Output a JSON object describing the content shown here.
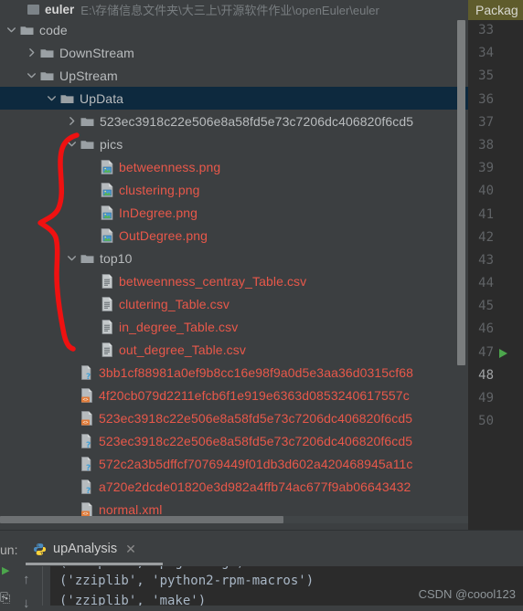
{
  "project_tree": {
    "header": {
      "name": "euler",
      "path": "E:\\存储信息文件夹\\大三上\\开源软件作业\\openEuler\\euler",
      "icon": "module-icon"
    },
    "rows": [
      {
        "label": "code",
        "type": "folder",
        "indent": 0,
        "chevron": "down",
        "selected": false
      },
      {
        "label": "DownStream",
        "type": "folder",
        "indent": 1,
        "chevron": "right",
        "selected": false
      },
      {
        "label": "UpStream",
        "type": "folder",
        "indent": 1,
        "chevron": "down",
        "selected": false
      },
      {
        "label": "UpData",
        "type": "folder",
        "indent": 2,
        "chevron": "down",
        "selected": true
      },
      {
        "label": "523ec3918c22e506e8a58fd5e73c7206dc406820f6cd5",
        "type": "folder",
        "indent": 3,
        "chevron": "right",
        "selected": false
      },
      {
        "label": "pics",
        "type": "folder",
        "indent": 3,
        "chevron": "down",
        "selected": false
      },
      {
        "label": "betweenness.png",
        "type": "image-file",
        "indent": 4,
        "chevron": "none",
        "selected": false
      },
      {
        "label": "clustering.png",
        "type": "image-file",
        "indent": 4,
        "chevron": "none",
        "selected": false
      },
      {
        "label": "InDegree.png",
        "type": "image-file",
        "indent": 4,
        "chevron": "none",
        "selected": false
      },
      {
        "label": "OutDegree.png",
        "type": "image-file",
        "indent": 4,
        "chevron": "none",
        "selected": false
      },
      {
        "label": "top10",
        "type": "folder",
        "indent": 3,
        "chevron": "down",
        "selected": false
      },
      {
        "label": "betweenness_centray_Table.csv",
        "type": "text-file",
        "indent": 4,
        "chevron": "none",
        "selected": false
      },
      {
        "label": "clutering_Table.csv",
        "type": "text-file",
        "indent": 4,
        "chevron": "none",
        "selected": false
      },
      {
        "label": "in_degree_Table.csv",
        "type": "text-file",
        "indent": 4,
        "chevron": "none",
        "selected": false
      },
      {
        "label": "out_degree_Table.csv",
        "type": "text-file",
        "indent": 4,
        "chevron": "none",
        "selected": false
      },
      {
        "label": "3bb1cf88981a0ef9b8cc16e98f9a0d5e3aa36d0315cf68",
        "type": "unknown-file",
        "indent": 3,
        "chevron": "none",
        "selected": false
      },
      {
        "label": "4f20cb079d2211efcb6f1e919e6363d0853240617557c",
        "type": "xml-file",
        "indent": 3,
        "chevron": "none",
        "selected": false
      },
      {
        "label": "523ec3918c22e506e8a58fd5e73c7206dc406820f6cd5",
        "type": "xml-file",
        "indent": 3,
        "chevron": "none",
        "selected": false
      },
      {
        "label": "523ec3918c22e506e8a58fd5e73c7206dc406820f6cd5",
        "type": "unknown-file",
        "indent": 3,
        "chevron": "none",
        "selected": false
      },
      {
        "label": "572c2a3b5dffcf70769449f01db3d602a420468945a11c",
        "type": "unknown-file",
        "indent": 3,
        "chevron": "none",
        "selected": false
      },
      {
        "label": "a720e2dcde01820e3d982a4ffb74ac677f9ab06643432",
        "type": "unknown-file",
        "indent": 3,
        "chevron": "none",
        "selected": false
      },
      {
        "label": "normal.xml",
        "type": "xml-file",
        "indent": 3,
        "chevron": "none",
        "selected": false
      }
    ],
    "annotation": {
      "color": "#ef1111",
      "shape": "hand-drawn-brace"
    }
  },
  "editor": {
    "tab_label": "Packag",
    "gutter_lines": [
      "33",
      "34",
      "35",
      "36",
      "37",
      "38",
      "39",
      "40",
      "41",
      "42",
      "43",
      "44",
      "45",
      "46",
      "47",
      "48",
      "49",
      "50"
    ],
    "current_line": "48",
    "run_arrow_line": "47",
    "run_arrow_color": "#4ca64c"
  },
  "run_panel": {
    "label": "un:",
    "tab_title": "upAnalysis",
    "tab_icon": "python-icon",
    "close_icon": "close-icon",
    "toolbar_icons": [
      "up-arrow-icon",
      "down-arrow-icon"
    ],
    "console_lines": [
      "('zziplib', 'pkgconfig')",
      "('zziplib', 'python2-rpm-macros')",
      "('zziplib', 'make')"
    ],
    "watermark": "CSDN @coool123"
  },
  "colors": {
    "panel_bg": "#3c3f41",
    "editor_bg": "#2b2b2b",
    "selection": "#0d293e",
    "file_red": "#e8584a",
    "folder_text": "#b9bcbe",
    "tab_olive": "#5f5c2c"
  }
}
